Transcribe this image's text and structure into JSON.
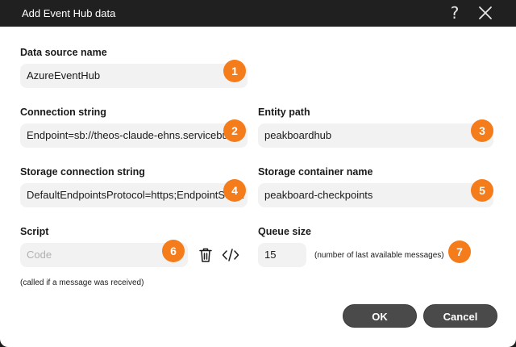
{
  "window": {
    "title": "Add Event Hub data",
    "help_glyph": "?"
  },
  "form": {
    "data_source_name": {
      "label": "Data source name",
      "value": "AzureEventHub",
      "badge": "1"
    },
    "connection_string": {
      "label": "Connection string",
      "value": "Endpoint=sb://theos-claude-ehns.servicebus",
      "badge": "2"
    },
    "entity_path": {
      "label": "Entity path",
      "value": "peakboardhub",
      "badge": "3"
    },
    "storage_connection_string": {
      "label": "Storage connection string",
      "value": "DefaultEndpointsProtocol=https;EndpointSuffix",
      "badge": "4"
    },
    "storage_container_name": {
      "label": "Storage container name",
      "value": "peakboard-checkpoints",
      "badge": "5"
    },
    "script": {
      "label": "Script",
      "placeholder": "Code",
      "badge": "6",
      "note": "(called if a message was received)"
    },
    "queue_size": {
      "label": "Queue size",
      "value": "15",
      "note": "(number of last available messages)",
      "badge": "7"
    }
  },
  "buttons": {
    "ok": "OK",
    "cancel": "Cancel"
  },
  "icons": {
    "help": "question-mark-icon",
    "close": "close-icon",
    "delete": "trash-icon",
    "code": "code-icon"
  },
  "colors": {
    "badge": "#f47c1a",
    "titlebar": "#202020",
    "button": "#4a4a4a"
  }
}
